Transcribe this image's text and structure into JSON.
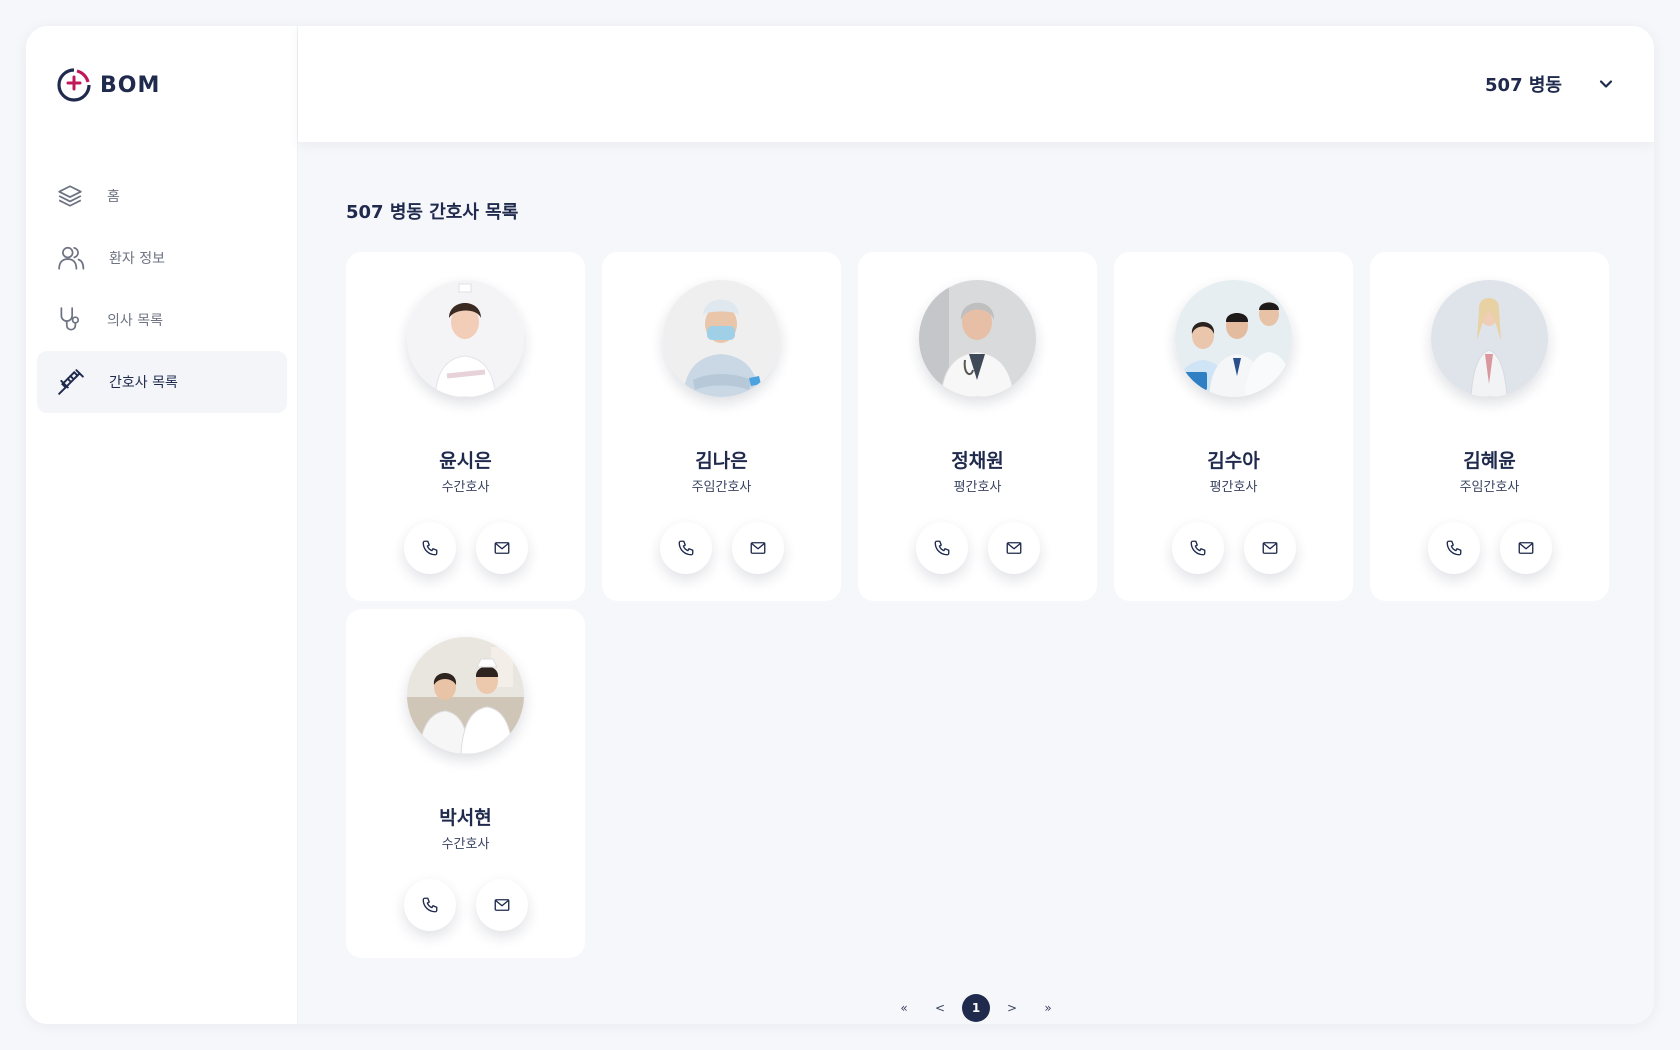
{
  "brand": {
    "name": "BOM"
  },
  "sidebar": {
    "items": [
      {
        "label": "홈",
        "icon": "layers-icon",
        "active": false
      },
      {
        "label": "환자 정보",
        "icon": "users-icon",
        "active": false
      },
      {
        "label": "의사 목록",
        "icon": "stethoscope-icon",
        "active": false
      },
      {
        "label": "간호사 목록",
        "icon": "syringe-icon",
        "active": true
      }
    ]
  },
  "header": {
    "ward_label": "507 병동",
    "dropdown_icon": "chevron-down-icon"
  },
  "main": {
    "title": "507 병동 간호사 목록",
    "nurses": [
      {
        "name": "윤시은",
        "role": "수간호사"
      },
      {
        "name": "김나은",
        "role": "주임간호사"
      },
      {
        "name": "정채원",
        "role": "평간호사"
      },
      {
        "name": "김수아",
        "role": "평간호사"
      },
      {
        "name": "김혜윤",
        "role": "주임간호사"
      },
      {
        "name": "박서현",
        "role": "수간호사"
      }
    ]
  },
  "pagination": {
    "first": "«",
    "prev": "<",
    "current": "1",
    "next": ">",
    "last": "»"
  },
  "colors": {
    "navy": "#1f2a4d",
    "accent": "#c2185b",
    "background": "#f6f7fa"
  }
}
